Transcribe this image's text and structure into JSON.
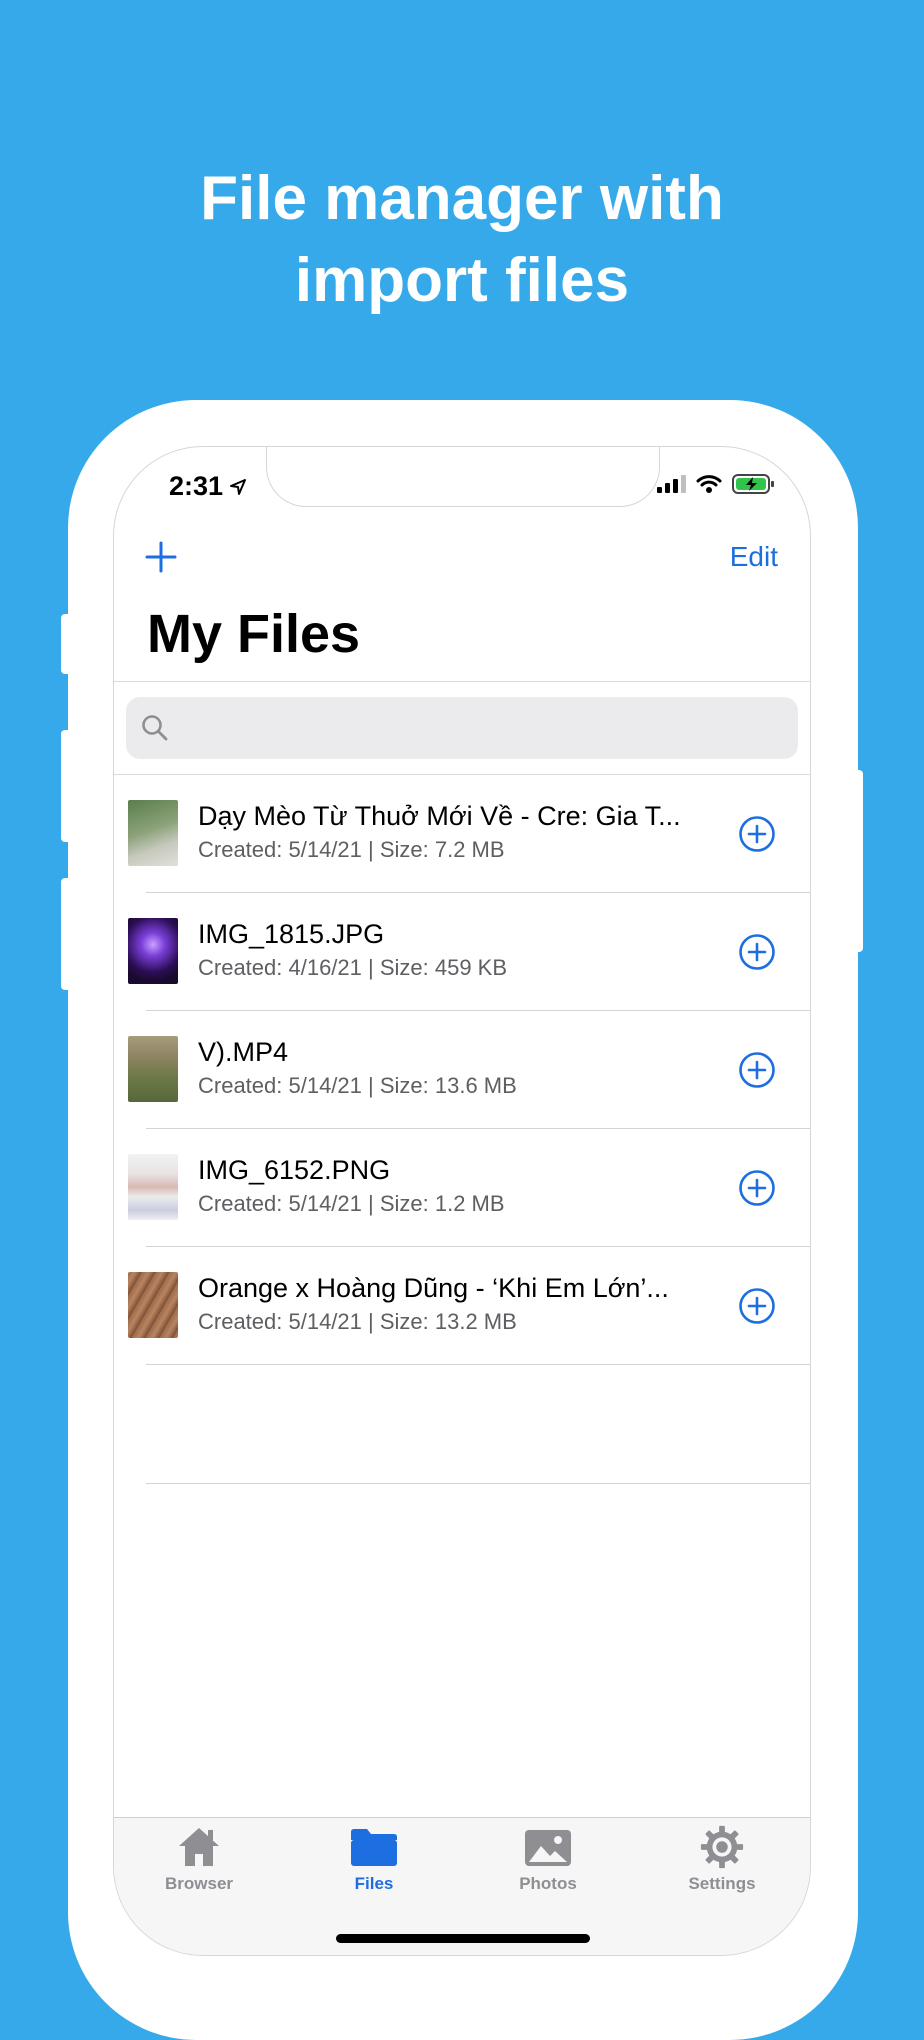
{
  "headline": {
    "line1": "File manager with",
    "line2": "import files"
  },
  "status_bar": {
    "time": "2:31"
  },
  "nav": {
    "add_icon": "plus-icon",
    "edit_label": "Edit",
    "title": "My Files"
  },
  "search": {
    "placeholder": ""
  },
  "files": [
    {
      "name": "Dạy Mèo Từ Thuở Mới Về - Cre: Gia T...",
      "meta": "Created: 5/14/21 | Size: 7.2 MB",
      "thumb_color": "#6b8f5e"
    },
    {
      "name": "IMG_1815.JPG",
      "meta": "Created: 4/16/21 | Size: 459 KB",
      "thumb_color": "#4a1e7a"
    },
    {
      "name": "V).MP4",
      "meta": "Created: 5/14/21 | Size: 13.6 MB",
      "thumb_color": "#7d7450"
    },
    {
      "name": "IMG_6152.PNG",
      "meta": "Created: 5/14/21 | Size: 1.2 MB",
      "thumb_color": "#e9e6e6"
    },
    {
      "name": "Orange x Hoàng Dũng - ‘Khi Em Lớn’...",
      "meta": "Created: 5/14/21 | Size: 13.2 MB",
      "thumb_color": "#8a5a3c"
    }
  ],
  "tabs": [
    {
      "label": "Browser",
      "icon": "home-icon",
      "active": false
    },
    {
      "label": "Files",
      "icon": "folder-icon",
      "active": true
    },
    {
      "label": "Photos",
      "icon": "photo-icon",
      "active": false
    },
    {
      "label": "Settings",
      "icon": "gear-icon",
      "active": false
    }
  ],
  "colors": {
    "background": "#36a9ea",
    "accent": "#1d6ee0",
    "inactive": "#8e8e93"
  }
}
